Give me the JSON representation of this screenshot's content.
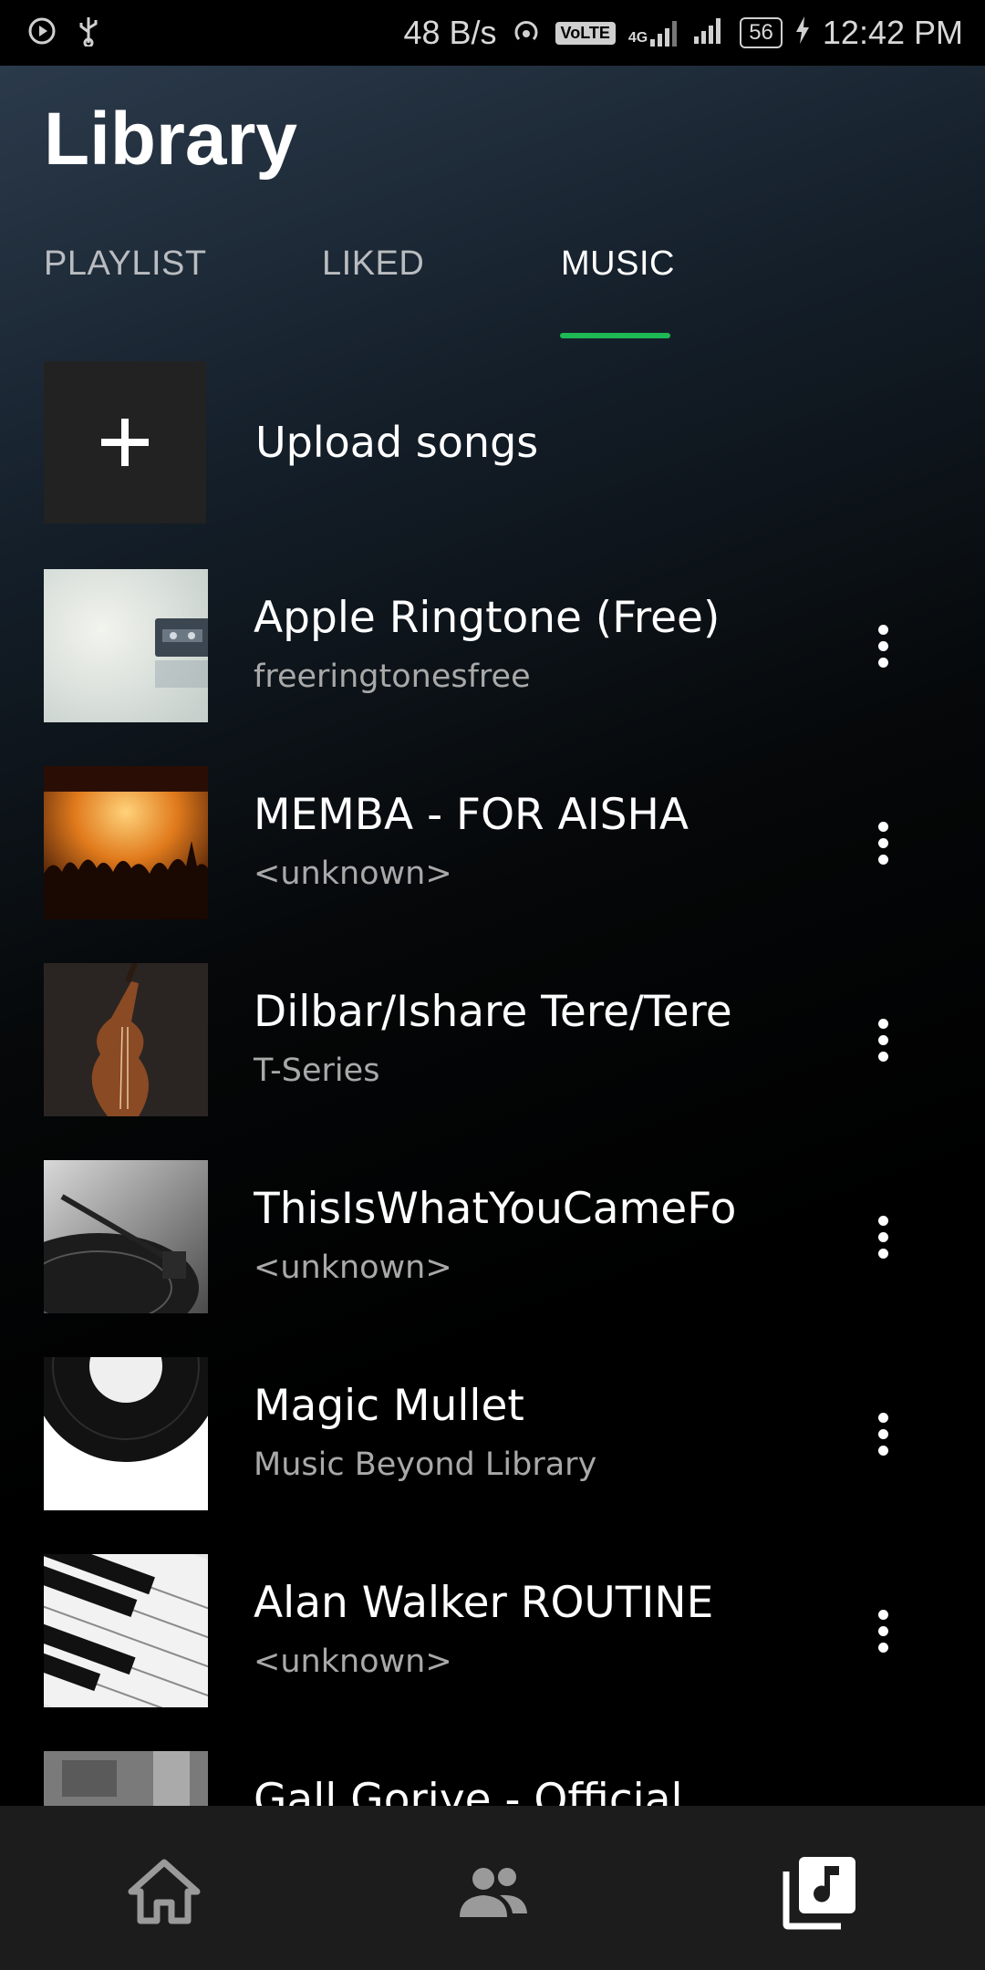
{
  "status_bar": {
    "speed": "48 B/s",
    "volte": "VoLTE",
    "network": "4G",
    "battery": "56",
    "time": "12:42 PM"
  },
  "header": {
    "title": "Library"
  },
  "tabs": [
    {
      "label": "PLAYLIST",
      "active": false
    },
    {
      "label": "LIKED",
      "active": false
    },
    {
      "label": "MUSIC",
      "active": true
    }
  ],
  "upload": {
    "label": "Upload songs"
  },
  "songs": [
    {
      "title": "Apple Ringtone (Free)",
      "artist": "freeringtonesfree",
      "art": "cassette"
    },
    {
      "title": "MEMBA - FOR AISHA",
      "artist": "<unknown>",
      "art": "concert"
    },
    {
      "title": "Dilbar/Ishare Tere/Tere",
      "artist": "T-Series",
      "art": "violin"
    },
    {
      "title": "ThisIsWhatYouCameFo",
      "artist": "<unknown>",
      "art": "turntable"
    },
    {
      "title": "Magic Mullet",
      "artist": "Music Beyond Library",
      "art": "vinyl"
    },
    {
      "title": "Alan Walker ROUTINE",
      "artist": "<unknown>",
      "art": "piano"
    },
    {
      "title": "Gall Goriye - Official",
      "artist": "",
      "art": "grey"
    }
  ],
  "bottom_nav": [
    {
      "icon": "home-icon",
      "active": false
    },
    {
      "icon": "people-icon",
      "active": false
    },
    {
      "icon": "library-music-icon",
      "active": true
    }
  ],
  "colors": {
    "accent": "#1db954",
    "nav_bg": "#1c1c1c",
    "inactive_icon": "#9a9a9a"
  }
}
